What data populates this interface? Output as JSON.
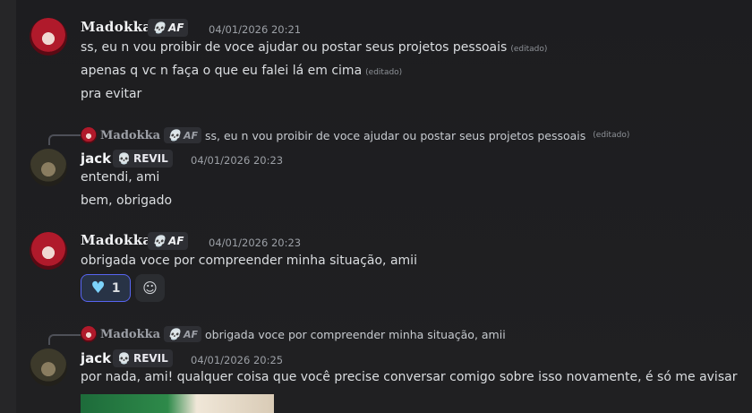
{
  "messages": [
    {
      "author": "Madokka",
      "tag": "AF",
      "timestamp": "04/01/2026 20:21",
      "lines": [
        {
          "text": "ss, eu n vou proibir de voce ajudar ou postar seus projetos pessoais",
          "edited": "(editado)"
        },
        {
          "text": "apenas q vc n faça o que eu falei lá em cima",
          "edited": "(editado)"
        },
        {
          "text": "pra evitar",
          "edited": ""
        }
      ]
    },
    {
      "reply": {
        "author": "Madokka",
        "tag": "AF",
        "text": "ss, eu n vou proibir de voce ajudar ou postar seus projetos pessoais",
        "edited": "(editado)"
      },
      "author": "jack",
      "tag": "REVIL",
      "timestamp": "04/01/2026 20:23",
      "lines": [
        {
          "text": "entendi, ami"
        },
        {
          "text": "bem, obrigado"
        }
      ]
    },
    {
      "author": "Madokka",
      "tag": "AF",
      "timestamp": "04/01/2026 20:23",
      "lines": [
        {
          "text": "obrigada voce por compreender minha situação, amii"
        }
      ],
      "reaction": {
        "emoji": "heart",
        "count": "1"
      }
    },
    {
      "reply": {
        "author": "Madokka",
        "tag": "AF",
        "text": "obrigada voce por compreender minha situação, amii"
      },
      "author": "jack",
      "tag": "REVIL",
      "timestamp": "04/01/2026 20:25",
      "lines": [
        {
          "text": "por nada, ami! qualquer coisa que você precise conversar comigo sobre isso novamente, é só me avisar"
        }
      ]
    }
  ],
  "colors": {
    "background": "#1f1f21",
    "reaction_bg": "#283346",
    "reaction_border": "#5865f2",
    "heart": "#7dd3fc",
    "skull_purple": "#c084fc"
  }
}
